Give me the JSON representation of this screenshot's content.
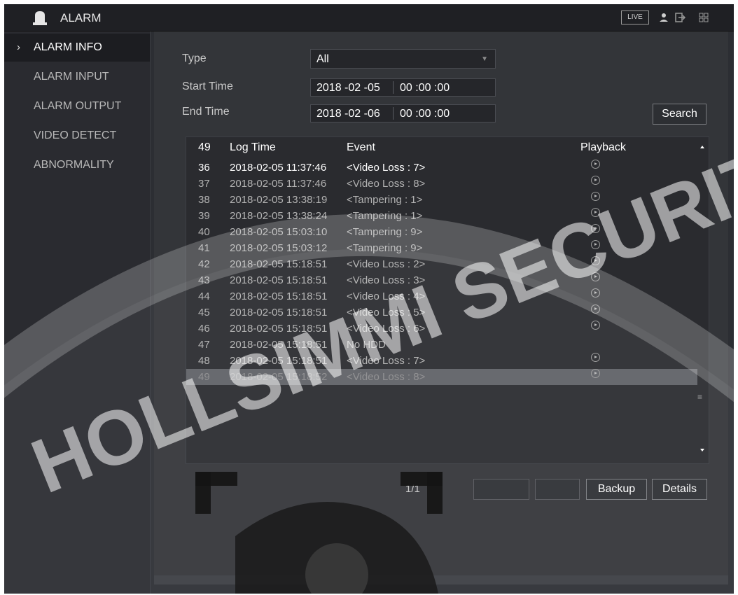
{
  "titlebar": {
    "app_title": "ALARM",
    "live_label": "LIVE",
    "icons": [
      "alarm-bell-icon",
      "user-icon",
      "logout-icon",
      "menu-grid-icon"
    ]
  },
  "sidebar": {
    "items": [
      {
        "label": "ALARM INFO",
        "active": true
      },
      {
        "label": "ALARM INPUT",
        "active": false
      },
      {
        "label": "ALARM OUTPUT",
        "active": false
      },
      {
        "label": "VIDEO DETECT",
        "active": false
      },
      {
        "label": "ABNORMALITY",
        "active": false
      }
    ]
  },
  "filters": {
    "type_label": "Type",
    "type_value": "All",
    "start_label": "Start Time",
    "start_date": "2018 -02 -05",
    "start_time": "00 :00 :00",
    "end_label": "End Time",
    "end_date": "2018 -02 -06",
    "end_time": "00 :00 :00",
    "search_label": "Search"
  },
  "table": {
    "headers": {
      "no": "49",
      "time": "Log Time",
      "event": "Event",
      "playback": "Playback"
    },
    "rows": [
      {
        "no": "36",
        "time": "2018-02-05 11:37:46",
        "event": "<Video Loss : 7>",
        "playback": true
      },
      {
        "no": "37",
        "time": "2018-02-05 11:37:46",
        "event": "<Video Loss : 8>",
        "playback": true
      },
      {
        "no": "38",
        "time": "2018-02-05 13:38:19",
        "event": "<Tampering : 1>",
        "playback": true
      },
      {
        "no": "39",
        "time": "2018-02-05 13:38:24",
        "event": "<Tampering : 1>",
        "playback": true
      },
      {
        "no": "40",
        "time": "2018-02-05 15:03:10",
        "event": "<Tampering : 9>",
        "playback": true
      },
      {
        "no": "41",
        "time": "2018-02-05 15:03:12",
        "event": "<Tampering : 9>",
        "playback": true
      },
      {
        "no": "42",
        "time": "2018-02-05 15:18:51",
        "event": "<Video Loss : 2>",
        "playback": true
      },
      {
        "no": "43",
        "time": "2018-02-05 15:18:51",
        "event": "<Video Loss : 3>",
        "playback": true
      },
      {
        "no": "44",
        "time": "2018-02-05 15:18:51",
        "event": "<Video Loss : 4>",
        "playback": true
      },
      {
        "no": "45",
        "time": "2018-02-05 15:18:51",
        "event": "<Video Loss : 5>",
        "playback": true
      },
      {
        "no": "46",
        "time": "2018-02-05 15:18:51",
        "event": "<Video Loss : 6>",
        "playback": true
      },
      {
        "no": "47",
        "time": "2018-02-05 15:18:51",
        "event": "No HDD",
        "playback": false
      },
      {
        "no": "48",
        "time": "2018-02-05 15:18:51",
        "event": "<Video Loss : 7>",
        "playback": true
      },
      {
        "no": "49",
        "time": "2018-02-05 15:18:52",
        "event": "<Video Loss : 8>",
        "playback": true,
        "selected": true
      }
    ]
  },
  "footer": {
    "page_indicator": "1/1",
    "backup_label": "Backup",
    "details_label": "Details"
  },
  "watermark": {
    "text": "HOLLSIMMI SECURITY"
  }
}
